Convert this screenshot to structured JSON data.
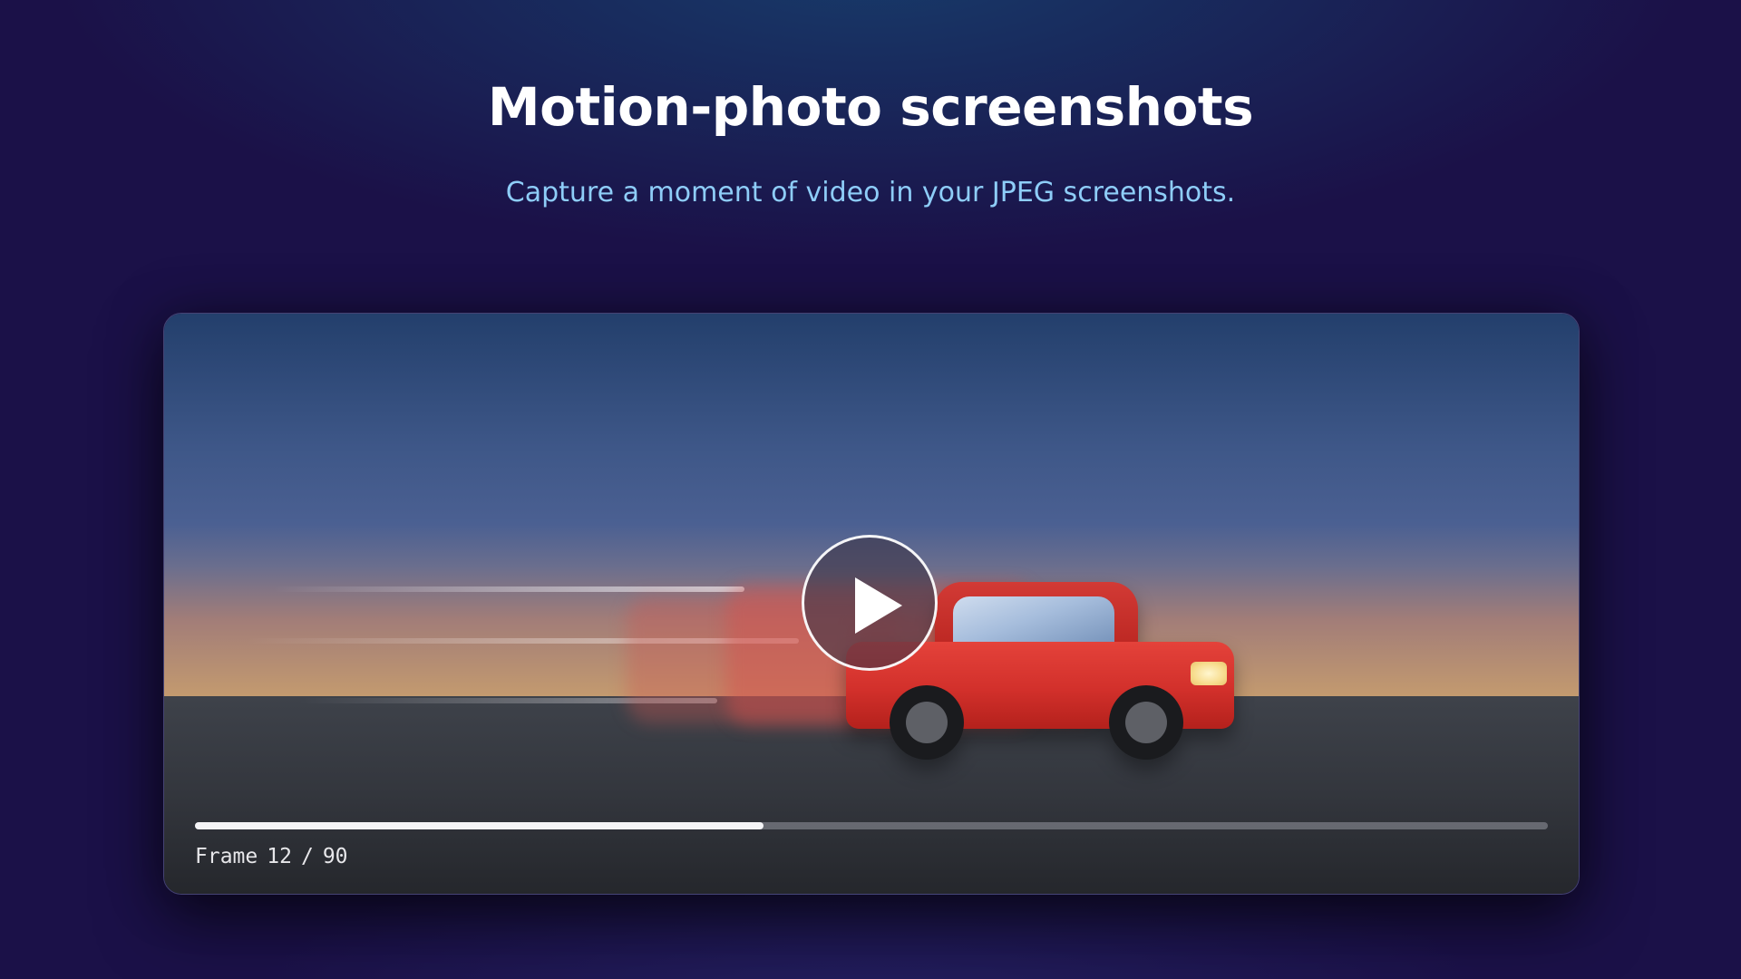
{
  "header": {
    "title": "Motion-photo screenshots",
    "subtitle": "Capture a moment of video in your JPEG screenshots."
  },
  "player": {
    "play_icon": "play-icon",
    "progress_fraction": 0.42,
    "frame_label": "Frame",
    "current_frame": "12",
    "separator": "/",
    "total_frames": "90"
  },
  "colors": {
    "page_background": "#1b1148",
    "title": "#ffffff",
    "subtitle": "#8ecdf8",
    "car": "#d2302b",
    "progress_fill": "#f4f4f6"
  }
}
